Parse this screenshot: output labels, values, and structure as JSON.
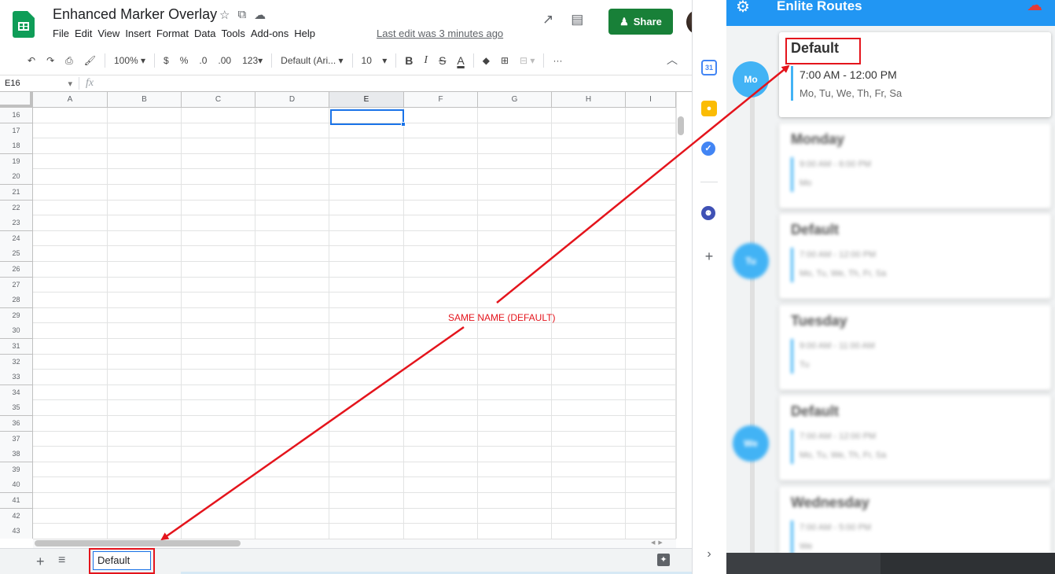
{
  "document": {
    "title": "Enhanced Marker Overlay",
    "last_edit": "Last edit was 3 minutes ago"
  },
  "menu": [
    "File",
    "Edit",
    "View",
    "Insert",
    "Format",
    "Data",
    "Tools",
    "Add-ons",
    "Help"
  ],
  "share_label": "Share",
  "toolbar": {
    "zoom": "100%",
    "currency": "$",
    "percent": "%",
    "dec_less": ".0",
    "dec_more": ".00",
    "number_format": "123",
    "font": "Default (Ari...",
    "font_size": "10",
    "bold": "B",
    "italic": "I",
    "strike": "S",
    "text_color": "A",
    "more": "···"
  },
  "formula_bar": {
    "cell_ref": "E16",
    "fx": "fx"
  },
  "columns": [
    "A",
    "B",
    "C",
    "D",
    "E",
    "F",
    "G",
    "H",
    "I"
  ],
  "selected_column": "E",
  "rows": [
    "16",
    "17",
    "18",
    "19",
    "20",
    "21",
    "22",
    "23",
    "24",
    "25",
    "26",
    "27",
    "28",
    "29",
    "30",
    "31",
    "32",
    "33",
    "34",
    "35",
    "36",
    "37",
    "38",
    "39",
    "40",
    "41",
    "42",
    "43"
  ],
  "sheet_tab": "Default",
  "annotation": "SAME NAME (DEFAULT)",
  "panel": {
    "title": "Enlite Routes",
    "cards": [
      {
        "circle": "Mo",
        "title": "Default",
        "time": "7:00 AM - 12:00 PM",
        "days": "Mo, Tu, We, Th, Fr, Sa",
        "blurred": false
      },
      {
        "circle": "",
        "title": "Monday",
        "time": "9:00 AM - 6:00 PM",
        "days": "Mo",
        "blurred": true
      },
      {
        "circle": "Tu",
        "title": "Default",
        "time": "7:00 AM - 12:00 PM",
        "days": "Mo, Tu, We, Th, Fr, Sa",
        "blurred": true
      },
      {
        "circle": "",
        "title": "Tuesday",
        "time": "9:00 AM - 11:00 AM",
        "days": "Tu",
        "blurred": true
      },
      {
        "circle": "We",
        "title": "Default",
        "time": "7:00 AM - 12:00 PM",
        "days": "Mo, Tu, We, Th, Fr, Sa",
        "blurred": true
      },
      {
        "circle": "",
        "title": "Wednesday",
        "time": "7:00 AM - 5:00 PM",
        "days": "We",
        "blurred": true
      }
    ]
  },
  "colors": {
    "brand_green": "#188038",
    "panel_blue": "#2196f3",
    "accent_blue": "#42b3f5",
    "annotation_red": "#e4141c",
    "selection_blue": "#1a73e8"
  }
}
